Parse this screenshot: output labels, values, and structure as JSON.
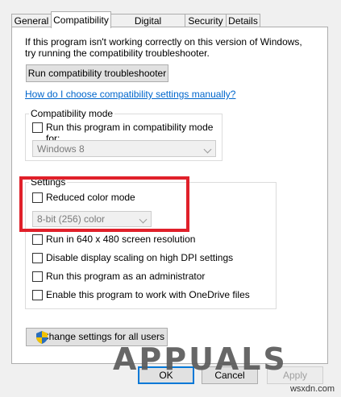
{
  "tabs": [
    {
      "label": "General"
    },
    {
      "label": "Compatibility"
    },
    {
      "label": "Digital Signatures"
    },
    {
      "label": "Security"
    },
    {
      "label": "Details"
    }
  ],
  "intro": {
    "line1": "If this program isn't working correctly on this version of Windows,",
    "line2": "try running the compatibility troubleshooter."
  },
  "troubleshooter_button": "Run compatibility troubleshooter",
  "help_link": "How do I choose compatibility settings manually?",
  "compat_mode": {
    "title": "Compatibility mode",
    "checkbox_label": "Run this program in compatibility mode for:",
    "checked": false,
    "os_value": "Windows 8"
  },
  "settings": {
    "title": "Settings",
    "reduced_color_label": "Reduced color mode",
    "color_value": "8-bit (256) color",
    "options": [
      {
        "label": "Run in 640 x 480 screen resolution",
        "checked": false
      },
      {
        "label": "Disable display scaling on high DPI settings",
        "checked": false
      },
      {
        "label": "Run this program as an administrator",
        "checked": false
      },
      {
        "label": "Enable this program to work with OneDrive files",
        "checked": false
      }
    ]
  },
  "change_all_button": "Change settings for all users",
  "footer": {
    "ok": "OK",
    "cancel": "Cancel",
    "apply": "Apply"
  },
  "watermark": "APPUALS",
  "site": "wsxdn.com"
}
